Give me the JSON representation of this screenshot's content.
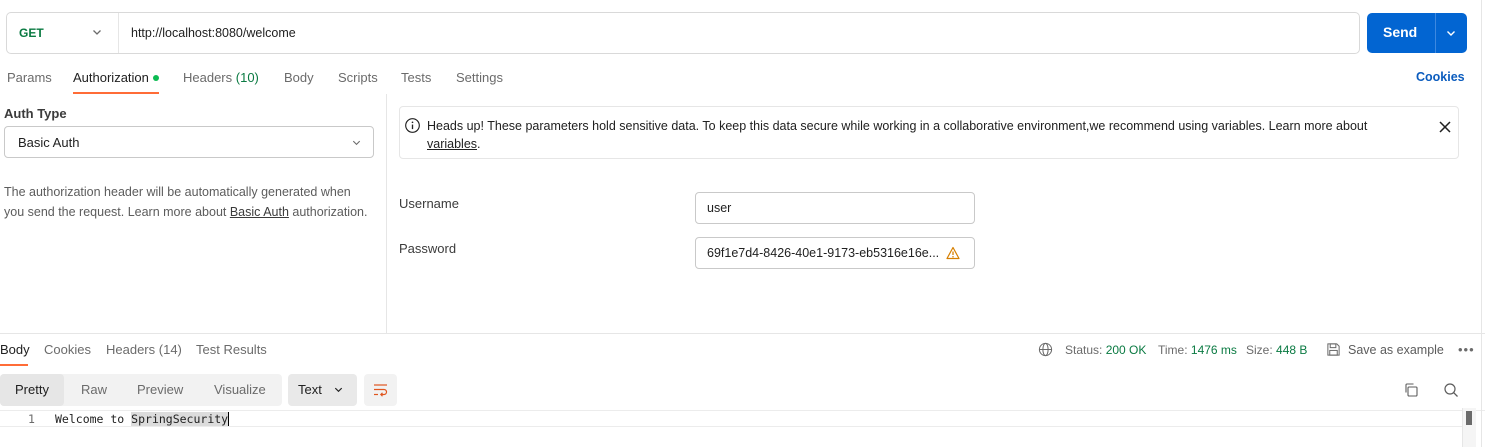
{
  "request": {
    "method": "GET",
    "url": "http://localhost:8080/welcome",
    "send_label": "Send"
  },
  "request_tabs": {
    "params": "Params",
    "authorization": "Authorization",
    "headers": "Headers",
    "headers_count": "(10)",
    "body": "Body",
    "scripts": "Scripts",
    "tests": "Tests",
    "settings": "Settings",
    "cookies": "Cookies"
  },
  "auth": {
    "type_label": "Auth Type",
    "type_value": "Basic Auth",
    "description_prefix": "The authorization header will be automatically generated when you send the request. Learn more about ",
    "description_link": "Basic Auth",
    "description_suffix": " authorization."
  },
  "alert": {
    "text": "Heads up! These parameters hold sensitive data. To keep this data secure while working in a collaborative environment,we recommend using variables. Learn more about ",
    "link": "variables",
    "suffix": "."
  },
  "fields": {
    "username_label": "Username",
    "username_value": "user",
    "password_label": "Password",
    "password_value": "69f1e7d4-8426-40e1-9173-eb5316e16e..."
  },
  "response_tabs": {
    "body": "Body",
    "cookies": "Cookies",
    "headers": "Headers",
    "headers_count": "(14)",
    "test_results": "Test Results"
  },
  "response_meta": {
    "status_label": "Status:",
    "status_value": "200 OK",
    "time_label": "Time:",
    "time_value": "1476 ms",
    "size_label": "Size:",
    "size_value": "448 B",
    "save_label": "Save as example",
    "more": "•••"
  },
  "view_toolbar": {
    "pretty": "Pretty",
    "raw": "Raw",
    "preview": "Preview",
    "visualize": "Visualize",
    "format": "Text"
  },
  "editor": {
    "line_number": "1",
    "code_prefix": "Welcome to ",
    "code_highlight": "SpringSecurity"
  },
  "colors": {
    "accent_orange": "#ff6c37",
    "send_blue": "#0265d2",
    "success_green": "#0a7a42"
  }
}
